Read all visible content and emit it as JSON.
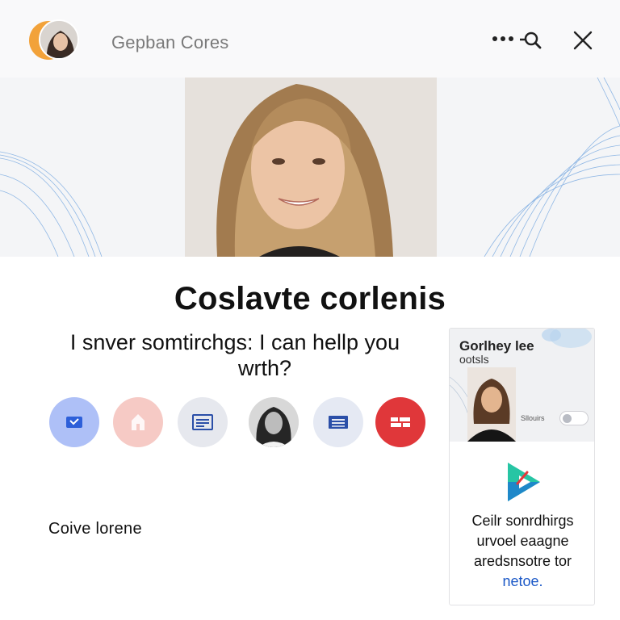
{
  "header": {
    "title": "Gepban Cores",
    "avatar_icon": "profile-avatar",
    "more_icon": "more-icon",
    "search_icon": "search-icon",
    "close_icon": "close-icon"
  },
  "hero": {
    "image": "portrait-photo"
  },
  "main": {
    "headline": "Coslavte corlenis",
    "prompt_line1": "I snver somtirchgs: I can hellp you",
    "prompt_line2": "wrth?",
    "chips": [
      {
        "icon": "send-icon",
        "color": "#aec0f7"
      },
      {
        "icon": "home-icon",
        "color": "#f6cac5"
      },
      {
        "icon": "document-icon",
        "color": "#e6e8ee"
      },
      {
        "icon": "person-photo",
        "color": "#e8e8e8"
      },
      {
        "icon": "list-icon",
        "color": "#e5e9f3"
      },
      {
        "icon": "grid-icon",
        "color": "#e0373a"
      }
    ],
    "bottom_label": "Coive lorene"
  },
  "side_card": {
    "title": "Gorlhey lee",
    "subtitle": "ootsls",
    "meta": "Sllouirs",
    "logo_icon": "play-logo-icon",
    "body_line1": "Ceilr sonrdhirgs",
    "body_line2": "urvoel eaagne",
    "body_line3": "aredsnsotre tor",
    "body_link": "netoe."
  },
  "colors": {
    "accent_blue": "#1b58c7",
    "chip_red": "#e0373a",
    "avatar_orange": "#f2a23a"
  }
}
